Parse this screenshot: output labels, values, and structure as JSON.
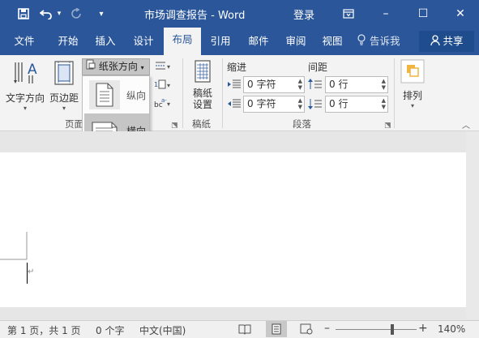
{
  "window": {
    "title": "市场调查报告 - Word",
    "login_label": "登录",
    "restore_icon": "ribbon-display-icon",
    "minimize": "–",
    "maximize": "☐",
    "close": "✕"
  },
  "qat": {
    "save_icon": "save-icon",
    "undo_icon": "undo-icon",
    "redo_icon": "redo-icon",
    "customize_icon": "customize-qat-icon"
  },
  "tabs": [
    {
      "label": "文件"
    },
    {
      "label": "开始"
    },
    {
      "label": "插入"
    },
    {
      "label": "设计"
    },
    {
      "label": "布局"
    },
    {
      "label": "引用"
    },
    {
      "label": "邮件"
    },
    {
      "label": "审阅"
    },
    {
      "label": "视图"
    }
  ],
  "tell_me": "告诉我",
  "share": "共享",
  "ribbon": {
    "text_direction": "文字方向",
    "margins": "页边距",
    "orientation": "纸张方向",
    "group_page_setup": "页面",
    "draft_paper": "稿纸设置",
    "draft_paper_line1": "稿纸",
    "draft_paper_line2": "设置",
    "group_draft": "稿纸",
    "indent_label": "缩进",
    "spacing_label": "间距",
    "indent_left": "0 字符",
    "indent_right": "0 字符",
    "spacing_before": "0 行",
    "spacing_after": "0 行",
    "group_paragraph": "段落",
    "arrange": "排列"
  },
  "orientation_menu": {
    "portrait": "纵向",
    "landscape": "横向",
    "selected": "横向"
  },
  "status": {
    "page": "第 1 页，共 1 页",
    "words": "0 个字",
    "language": "中文(中国)",
    "zoom": "140%",
    "zoom_level": 0.7
  },
  "colors": {
    "accent": "#2b579a",
    "ribbon_bg": "#f3f3f3"
  }
}
